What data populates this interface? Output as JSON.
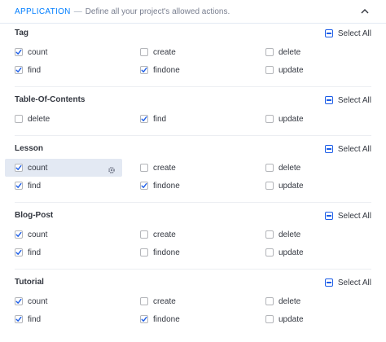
{
  "header": {
    "title": "APPLICATION",
    "dash": "—",
    "description": "Define all your project's allowed actions."
  },
  "select_all_label": "Select All",
  "sections": [
    {
      "name": "Tag",
      "rows": [
        [
          {
            "label": "count",
            "checked": true
          },
          {
            "label": "create",
            "checked": false
          },
          {
            "label": "delete",
            "checked": false
          }
        ],
        [
          {
            "label": "find",
            "checked": true
          },
          {
            "label": "findone",
            "checked": true
          },
          {
            "label": "update",
            "checked": false
          }
        ]
      ]
    },
    {
      "name": "Table-Of-Contents",
      "rows": [
        [
          {
            "label": "delete",
            "checked": false
          },
          {
            "label": "find",
            "checked": true
          },
          {
            "label": "update",
            "checked": false
          }
        ]
      ]
    },
    {
      "name": "Lesson",
      "rows": [
        [
          {
            "label": "count",
            "checked": true,
            "highlight": true
          },
          {
            "label": "create",
            "checked": false
          },
          {
            "label": "delete",
            "checked": false
          }
        ],
        [
          {
            "label": "find",
            "checked": true
          },
          {
            "label": "findone",
            "checked": true
          },
          {
            "label": "update",
            "checked": false
          }
        ]
      ]
    },
    {
      "name": "Blog-Post",
      "rows": [
        [
          {
            "label": "count",
            "checked": true
          },
          {
            "label": "create",
            "checked": false
          },
          {
            "label": "delete",
            "checked": false
          }
        ],
        [
          {
            "label": "find",
            "checked": true
          },
          {
            "label": "findone",
            "checked": false
          },
          {
            "label": "update",
            "checked": false
          }
        ]
      ]
    },
    {
      "name": "Tutorial",
      "rows": [
        [
          {
            "label": "count",
            "checked": true
          },
          {
            "label": "create",
            "checked": false
          },
          {
            "label": "delete",
            "checked": false
          }
        ],
        [
          {
            "label": "find",
            "checked": true
          },
          {
            "label": "findone",
            "checked": true
          },
          {
            "label": "update",
            "checked": false
          }
        ]
      ]
    }
  ],
  "colors": {
    "accent": "#007eff",
    "checkmark": "#1c5de7",
    "highlight_bg": "#e3e9f3"
  },
  "icons": {
    "collapse": "chevron-up-icon",
    "settings": "gear-icon"
  }
}
